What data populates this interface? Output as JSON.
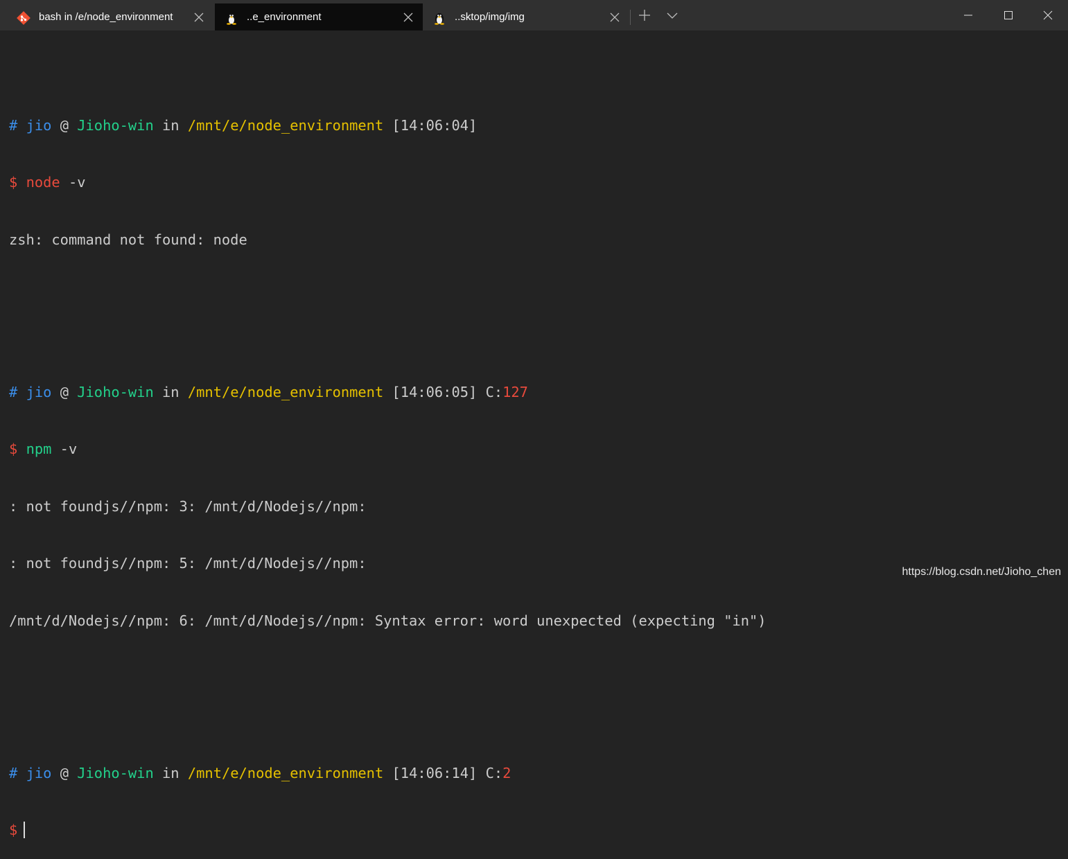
{
  "tabs": [
    {
      "title": "bash in /e/node_environment",
      "icon": "git-icon",
      "active": false
    },
    {
      "title": "..e_environment",
      "icon": "linux-penguin-icon",
      "active": true
    },
    {
      "title": "..sktop/img/img",
      "icon": "linux-penguin-icon",
      "active": false
    }
  ],
  "prompt": {
    "hash": "#",
    "user": "jio",
    "at": "@",
    "host": "Jioho-win",
    "in": "in",
    "path": "/mnt/e/node_environment",
    "dollar": "$",
    "code_label": "C:"
  },
  "blocks": [
    {
      "time": "[14:06:04]",
      "exit_code": "",
      "cmd": "node",
      "args": " -v",
      "output": [
        "zsh: command not found: node"
      ]
    },
    {
      "time": "[14:06:05]",
      "exit_code": "127",
      "cmd": "npm",
      "args": " -v",
      "output": [
        ": not foundjs//npm: 3: /mnt/d/Nodejs//npm:",
        ": not foundjs//npm: 5: /mnt/d/Nodejs//npm:",
        "/mnt/d/Nodejs//npm: 6: /mnt/d/Nodejs//npm: Syntax error: word unexpected (expecting \"in\")"
      ]
    },
    {
      "time": "[14:06:14]",
      "exit_code": "2",
      "cmd": "",
      "args": "",
      "output": []
    }
  ],
  "watermark": "https://blog.csdn.net/Jioho_chen",
  "colors": {
    "background": "#232323",
    "titlebar": "#303030",
    "active_tab": "#0c0c0c",
    "blue": "#3b8eea",
    "green": "#23d18b",
    "yellow": "#e5c000",
    "red": "#e84a3c"
  }
}
